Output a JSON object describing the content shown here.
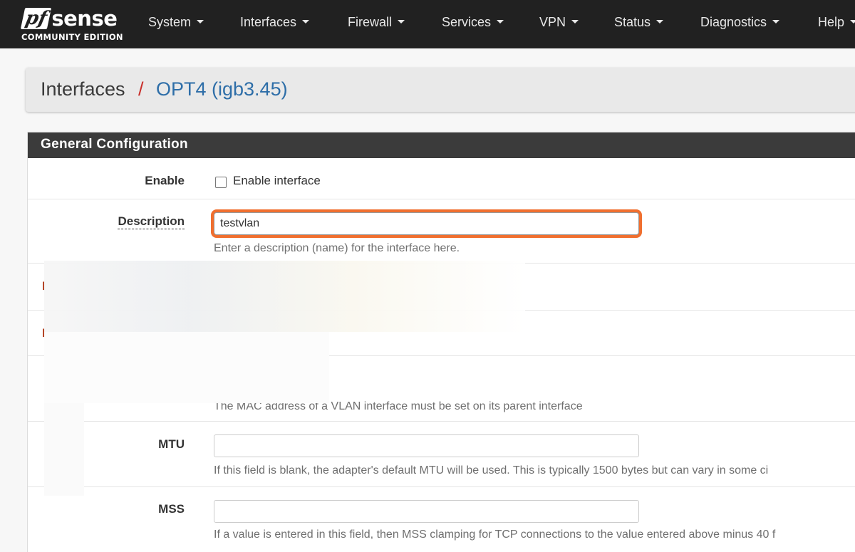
{
  "app": {
    "brand_main": "sense",
    "brand_prefix": "pf",
    "brand_sub": "COMMUNITY EDITION"
  },
  "nav": {
    "items": [
      {
        "label": "System"
      },
      {
        "label": "Interfaces"
      },
      {
        "label": "Firewall"
      },
      {
        "label": "Services"
      },
      {
        "label": "VPN"
      },
      {
        "label": "Status"
      },
      {
        "label": "Diagnostics"
      },
      {
        "label": "Help"
      }
    ]
  },
  "breadcrumb": {
    "root": "Interfaces",
    "separator": "/",
    "current": "OPT4 (igb3.45)"
  },
  "panel": {
    "title": "General Configuration",
    "enable": {
      "label": "Enable",
      "checkbox_label": "Enable interface",
      "checked": false
    },
    "description": {
      "label": "Description",
      "value": "testvlan",
      "help": "Enter a description (name) for the interface here."
    },
    "mac": {
      "help": "The MAC address of a VLAN interface must be set on its parent interface"
    },
    "mtu": {
      "label": "MTU",
      "value": "",
      "help": "If this field is blank, the adapter's default MTU will be used. This is typically 1500 bytes but can vary in some ci"
    },
    "mss": {
      "label": "MSS",
      "value": "",
      "help": "If a value is entered in this field, then MSS clamping for TCP connections to the value entered above minus 40 f"
    }
  },
  "colors": {
    "navbar_bg": "#212121",
    "panel_heading_bg": "#3b3b3b",
    "breadcrumb_link": "#2e6ea8",
    "breadcrumb_separator": "#c9302c",
    "focus_ring": "#f06f2f"
  }
}
